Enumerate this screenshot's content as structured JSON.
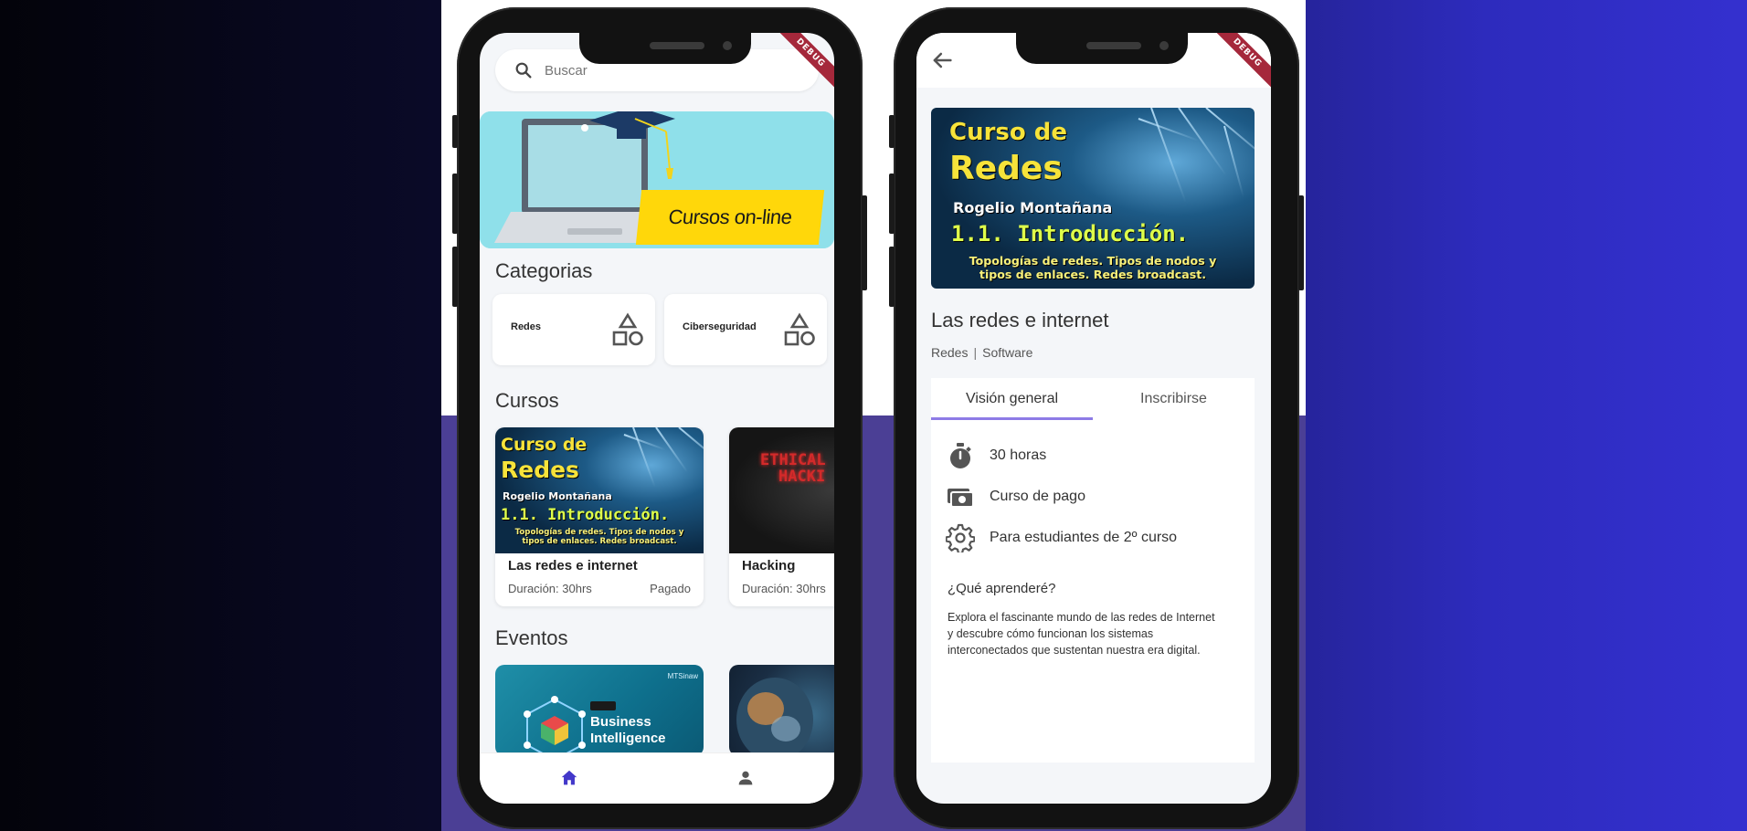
{
  "colors": {
    "accent": "#8d7be6",
    "nav_active": "#4338ca",
    "banner_bg": "#8fe0ea",
    "banner_label_bg": "#ffd70a",
    "debug_banner": "#a5283b"
  },
  "debug_label": "DEBUG",
  "home": {
    "search": {
      "placeholder": "Buscar"
    },
    "banner": {
      "label": "Cursos on-line"
    },
    "categories_title": "Categorias",
    "categories": [
      {
        "label": "Redes",
        "icon": "shapes-icon"
      },
      {
        "label": "Ciberseguridad",
        "icon": "shapes-icon"
      }
    ],
    "courses_title": "Cursos",
    "courses": [
      {
        "title": "Las redes e internet",
        "duration": "Duración: 30hrs",
        "price": "Pagado"
      },
      {
        "title": "Hacking",
        "duration": "Duración: 30hrs",
        "price": ""
      }
    ],
    "hacking_image_text": [
      "ETHICAL",
      "HACKI"
    ],
    "events_title": "Eventos",
    "events": [
      {
        "badge": "MTSinaw",
        "title_line1": "Business",
        "title_line2": "Intelligence"
      }
    ],
    "nav": [
      {
        "icon": "home-icon",
        "active": true
      },
      {
        "icon": "person-icon",
        "active": false
      }
    ]
  },
  "course_image": {
    "line1": "Curso de",
    "line2": "Redes",
    "author": "Rogelio Montañana",
    "chapter": "1.1. Introducción.",
    "subtitle_line1": "Topologías de redes. Tipos de nodos y",
    "subtitle_line2": "tipos de enlaces. Redes broadcast."
  },
  "detail": {
    "title": "Las redes e internet",
    "tags": [
      "Redes",
      "Software"
    ],
    "tabs": [
      {
        "label": "Visión general",
        "active": true
      },
      {
        "label": "Inscribirse",
        "active": false
      }
    ],
    "features": [
      {
        "icon": "stopwatch-icon",
        "text": "30 horas"
      },
      {
        "icon": "payment-icon",
        "text": "Curso de pago"
      },
      {
        "icon": "gear-icon",
        "text": "Para estudiantes de 2º curso"
      }
    ],
    "learn_heading": "¿Qué aprenderé?",
    "learn_text": "Explora el fascinante mundo de las redes de Internet y descubre cómo funcionan los sistemas interconectados que sustentan nuestra era digital."
  }
}
